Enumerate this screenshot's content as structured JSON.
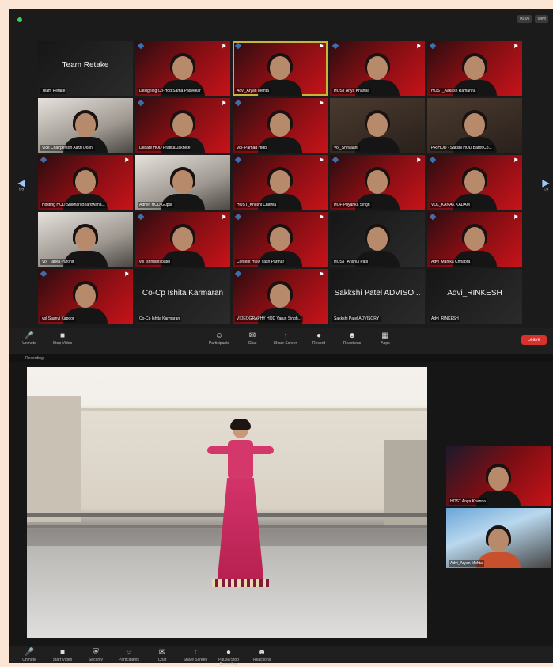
{
  "meeting1": {
    "view_buttons": [
      "00:00",
      "View"
    ],
    "participants": [
      {
        "label": "Team Retake",
        "display_name": "Team Retake",
        "bg": "dark"
      },
      {
        "label": "Designing Co-Hod Sama Padvekar",
        "bg": "red"
      },
      {
        "label": "Advi_Aryan Mehta",
        "bg": "red",
        "speaking": true
      },
      {
        "label": "HOST Anya Khanna",
        "bg": "red"
      },
      {
        "label": "HOST_Aakash Ramanna",
        "bg": "red"
      },
      {
        "label": "Vice Chairperson Aarzi Doshi",
        "bg": "room"
      },
      {
        "label": "Debate HOD Pratika Jakhete",
        "bg": "red"
      },
      {
        "label": "Vol- Parnad Hidd",
        "bg": "red"
      },
      {
        "label": "Vol_Shrivaani",
        "bg": "warm"
      },
      {
        "label": "PR HOD - Sakshi HOD Barot Co...",
        "bg": "warm"
      },
      {
        "label": "Hosting HOD Shikhari Bhardwaha...",
        "bg": "red"
      },
      {
        "label": "Admin HOD Gupta",
        "bg": "room"
      },
      {
        "label": "HOST_Khushi Chawla",
        "bg": "red"
      },
      {
        "label": "HOF Priyanka Singh",
        "bg": "red"
      },
      {
        "label": "VOL_KANAK KADAM",
        "bg": "red"
      },
      {
        "label": "Vol_Tanya Purohit",
        "bg": "room"
      },
      {
        "label": "vol_shrushti patel",
        "bg": "red"
      },
      {
        "label": "Content HOD Yash Parmar",
        "bg": "red"
      },
      {
        "label": "HOST_Anshul Patil",
        "bg": "dark"
      },
      {
        "label": "Advi_Mahika Chhabra",
        "bg": "red"
      },
      {
        "label": "vol Saanvi Kapoor",
        "bg": "red"
      },
      {
        "label": "Co-Cp Ishita Karmaran",
        "display_name": "Co-Cp Ishita Karmaran",
        "bg": "dark"
      },
      {
        "label": "VIDEOGRAPHY HOD Varun Singh...",
        "bg": "red"
      },
      {
        "label": "Sakkshi Patel ADVISORY",
        "display_name": "Sakkshi Patel ADVISO...",
        "bg": "dark"
      },
      {
        "label": "Advi_RINKESH",
        "display_name": "Advi_RINKESH",
        "bg": "dark"
      }
    ],
    "nav": {
      "left_page": "1/2",
      "right_page": "1/2"
    },
    "toolbar": {
      "left": [
        {
          "icon": "microphone-icon",
          "label": "Unmute"
        },
        {
          "icon": "video-icon",
          "label": "Stop Video"
        }
      ],
      "center": [
        {
          "icon": "participants-icon",
          "label": "Participants"
        },
        {
          "icon": "chat-icon",
          "label": "Chat"
        },
        {
          "icon": "share-screen-icon",
          "label": "Share Screen"
        },
        {
          "icon": "record-icon",
          "label": "Record"
        },
        {
          "icon": "reactions-icon",
          "label": "Reactions"
        },
        {
          "icon": "apps-icon",
          "label": "Apps"
        }
      ],
      "leave": "Leave"
    }
  },
  "meeting2": {
    "view_status": "Recording",
    "side_participants": [
      {
        "label": "HOST Anya Khanna"
      },
      {
        "label": "Advi_Aryan Mehta"
      }
    ],
    "toolbar": [
      {
        "icon": "microphone-icon",
        "label": "Unmute"
      },
      {
        "icon": "video-icon",
        "label": "Start Video"
      },
      {
        "icon": "security-icon",
        "label": "Security"
      },
      {
        "icon": "participants-icon",
        "label": "Participants"
      },
      {
        "icon": "chat-icon",
        "label": "Chat"
      },
      {
        "icon": "share-screen-icon",
        "label": "Share Screen"
      },
      {
        "icon": "record-icon",
        "label": "Pause/Stop Recording"
      },
      {
        "icon": "reactions-icon",
        "label": "Reactions"
      }
    ]
  }
}
